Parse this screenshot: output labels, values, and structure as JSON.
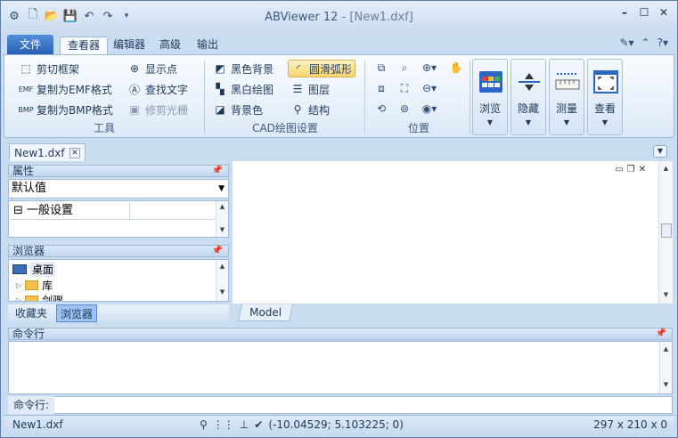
{
  "window": {
    "app_title": "ABViewer 12",
    "doc_title": "[New1.dxf]",
    "title_sep": " - "
  },
  "quick_access": [
    "app-icon",
    "new-icon",
    "open-icon",
    "save-icon",
    "undo-icon",
    "redo-icon",
    "customize-icon"
  ],
  "window_controls": [
    "minimize",
    "maximize",
    "close"
  ],
  "ribbon_tabs": {
    "file": "文件",
    "viewer": "查看器",
    "editor": "编辑器",
    "advanced": "高级",
    "output": "输出"
  },
  "ribbon": {
    "tools": {
      "label": "工具",
      "clip_frame": "剪切框架",
      "copy_emf": "复制为EMF格式",
      "copy_bmp": "复制为BMP格式",
      "show_points": "显示点",
      "find_text": "查找文字",
      "trim_raster": "修剪光栅"
    },
    "cad_settings": {
      "label": "CAD绘图设置",
      "black_bg": "黑色背景",
      "bw_drawing": "黑白绘图",
      "bg_color": "背景色",
      "smooth_arcs": "圆滑弧形",
      "layers": "图层",
      "structure": "结构"
    },
    "position": {
      "label": "位置"
    },
    "big": {
      "browse": "浏览",
      "hide": "隐藏",
      "measure": "测量",
      "view": "查看"
    }
  },
  "doc_tab": {
    "name": "New1.dxf"
  },
  "properties": {
    "title": "属性",
    "combo_value": "默认值",
    "section": "一般设置"
  },
  "browser": {
    "title": "浏览器",
    "nodes": [
      "桌面",
      "库",
      "剑骤"
    ]
  },
  "bottom_tabs": {
    "favorites": "收藏夹",
    "browser": "浏览器"
  },
  "model_tab": "Model",
  "command": {
    "title": "命令行",
    "input_label": "命令行:"
  },
  "status": {
    "file": "New1.dxf",
    "coords": "(-10.04529; 5.103225; 0)",
    "size": "297 x 210 x 0"
  },
  "colors": {
    "accent": "#2a62b5",
    "highlight": "#ffd66e",
    "ribbon_bg": "#e8f1fb"
  }
}
